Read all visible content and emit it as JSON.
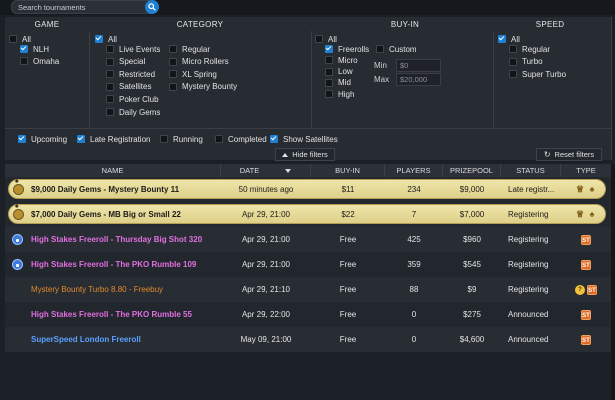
{
  "search": {
    "placeholder": "Search tournaments"
  },
  "filters": {
    "game": {
      "header": "GAME",
      "options": [
        {
          "label": "All",
          "checked": false
        },
        {
          "label": "NLH",
          "checked": true
        },
        {
          "label": "Omaha",
          "checked": false
        }
      ]
    },
    "category": {
      "header": "CATEGORY",
      "all": {
        "label": "All",
        "checked": true
      },
      "col1": [
        {
          "label": "Live Events",
          "checked": false
        },
        {
          "label": "Special",
          "checked": false
        },
        {
          "label": "Restricted",
          "checked": false
        },
        {
          "label": "Satellites",
          "checked": false
        },
        {
          "label": "Poker Club",
          "checked": false
        },
        {
          "label": "Daily Gems",
          "checked": false
        }
      ],
      "col2": [
        {
          "label": "Regular",
          "checked": false
        },
        {
          "label": "Micro Rollers",
          "checked": false
        },
        {
          "label": "XL Spring",
          "checked": false
        },
        {
          "label": "Mystery Bounty",
          "checked": false
        }
      ]
    },
    "buyin": {
      "header": "BUY-IN",
      "all": {
        "label": "All",
        "checked": false
      },
      "options": [
        {
          "label": "Freerolls",
          "checked": true
        },
        {
          "label": "Micro",
          "checked": false
        },
        {
          "label": "Low",
          "checked": false
        },
        {
          "label": "Mid",
          "checked": false
        },
        {
          "label": "High",
          "checked": false
        }
      ],
      "custom": {
        "label": "Custom",
        "checked": false
      },
      "min_label": "Min",
      "min_value": "$0",
      "max_label": "Max",
      "max_value": "$20,000"
    },
    "speed": {
      "header": "SPEED",
      "all": {
        "label": "All",
        "checked": true
      },
      "options": [
        {
          "label": "Regular",
          "checked": false
        },
        {
          "label": "Turbo",
          "checked": false
        },
        {
          "label": "Super Turbo",
          "checked": false
        }
      ]
    },
    "status": [
      {
        "label": "Upcoming",
        "checked": true
      },
      {
        "label": "Late Registration",
        "checked": true
      },
      {
        "label": "Running",
        "checked": false
      },
      {
        "label": "Completed",
        "checked": false
      },
      {
        "label": "Show Satellites",
        "checked": true
      }
    ],
    "hide_label": "Hide filters",
    "reset_label": "Reset filters"
  },
  "table": {
    "headers": {
      "name": "NAME",
      "date": "DATE",
      "buyin": "BUY-IN",
      "players": "PLAYERS",
      "prizepool": "PRIZEPOOL",
      "status": "STATUS",
      "type": "TYPE"
    },
    "rows": [
      {
        "name": "$9,000 Daily Gems - Mystery Bounty 11",
        "date": "50 minutes ago",
        "buyin": "$11",
        "players": "234",
        "prizepool": "$9,000",
        "status": "Late registr...",
        "style": "hl",
        "icon": "spade-circle-icon",
        "type": [
          "trophy-icon",
          "spade-icon"
        ]
      },
      {
        "name": "$7,000 Daily Gems - MB Big or Small 22",
        "date": "Apr 29, 21:00",
        "buyin": "$22",
        "players": "7",
        "prizepool": "$7,000",
        "status": "Registering",
        "style": "hl",
        "icon": "spade-circle-icon",
        "type": [
          "trophy-icon",
          "spade-icon"
        ]
      },
      {
        "name": "High Stakes Freeroll - Thursday Big Shot 320",
        "date": "Apr 29, 21:00",
        "buyin": "Free",
        "players": "425",
        "prizepool": "$960",
        "status": "Registering",
        "style": "alt",
        "color": "pink",
        "icon": "lock-icon",
        "type": [
          "super-turbo-icon"
        ]
      },
      {
        "name": "High Stakes Freeroll - The PKO Rumble 109",
        "date": "Apr 29, 21:00",
        "buyin": "Free",
        "players": "359",
        "prizepool": "$545",
        "status": "Registering",
        "style": "base",
        "color": "pink",
        "icon": "lock-icon",
        "type": [
          "super-turbo-icon"
        ]
      },
      {
        "name": "Mystery Bounty Turbo 8.80 - Freebuy",
        "date": "Apr 29, 21:10",
        "buyin": "Free",
        "players": "88",
        "prizepool": "$9",
        "status": "Registering",
        "style": "alt",
        "color": "orange",
        "icon": "",
        "type": [
          "mystery-icon",
          "super-turbo-icon"
        ]
      },
      {
        "name": "High Stakes Freeroll - The PKO Rumble 55",
        "date": "Apr 29, 22:00",
        "buyin": "Free",
        "players": "0",
        "prizepool": "$275",
        "status": "Announced",
        "style": "base",
        "color": "pink",
        "icon": "",
        "type": [
          "super-turbo-icon"
        ]
      },
      {
        "name": "SuperSpeed London Freeroll",
        "date": "May 09, 21:00",
        "buyin": "Free",
        "players": "0",
        "prizepool": "$4,600",
        "status": "Announced",
        "style": "alt",
        "color": "blue",
        "icon": "",
        "type": [
          "super-turbo-icon"
        ]
      }
    ]
  },
  "colors": {
    "accent": "#1e7fd3",
    "highlight": "#eee5a8",
    "pink": "#e070e0",
    "blue": "#5aa0ff",
    "orange": "#e08a2e"
  }
}
